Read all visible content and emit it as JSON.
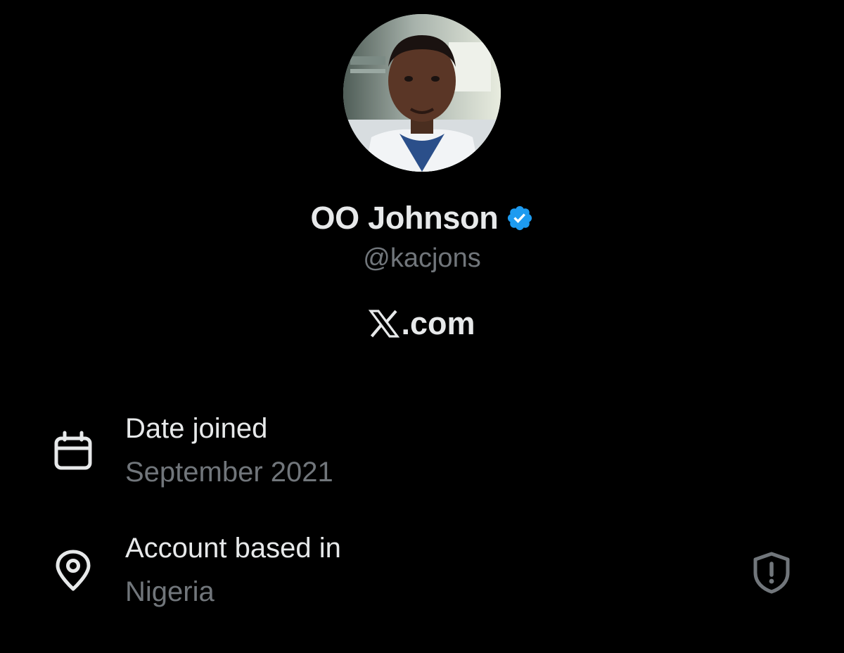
{
  "profile": {
    "display_name": "OO Johnson",
    "handle": "@kacjons",
    "verified": true,
    "brand_domain": ".com"
  },
  "details": {
    "date_joined": {
      "label": "Date joined",
      "value": "September 2021",
      "icon": "calendar-icon"
    },
    "location": {
      "label": "Account based in",
      "value": "Nigeria",
      "icon": "location-pin-icon",
      "action_icon": "shield-alert-icon"
    }
  },
  "colors": {
    "background": "#000000",
    "primary_text": "#e7e9ea",
    "secondary_text": "#71767b",
    "verified_blue": "#1d9bf0"
  }
}
